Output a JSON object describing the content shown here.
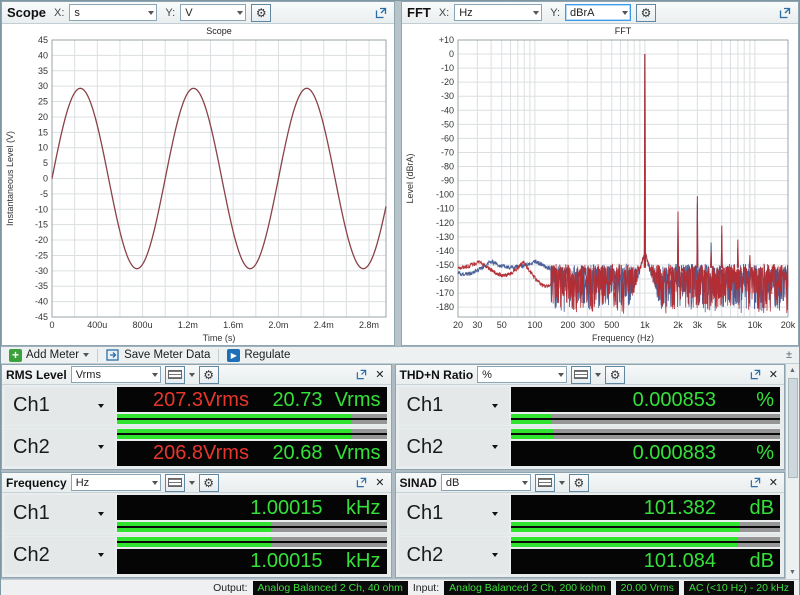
{
  "icons": {
    "add": "+",
    "play": "▶",
    "gear": "⚙",
    "caret": "",
    "close": "✕",
    "scroll_up": "▲",
    "scroll_down": "▼",
    "pin": "±"
  },
  "scope_panel": {
    "title": "Scope",
    "x_label": "X:",
    "x_value": "s",
    "y_label": "Y:",
    "y_value": "V"
  },
  "fft_panel": {
    "title": "FFT",
    "x_label": "X:",
    "x_value": "Hz",
    "y_label": "Y:",
    "y_value": "dBrA"
  },
  "toolbar": {
    "add_meter": "Add Meter",
    "save_meter_data": "Save Meter Data",
    "regulate": "Regulate"
  },
  "chart_data": [
    {
      "type": "line",
      "title": "Scope",
      "xlabel": "Time (s)",
      "ylabel": "Instantaneous Level (V)",
      "ylim": [
        -45,
        45
      ],
      "ytick_step": 5,
      "xlim_s": [
        0,
        0.00295
      ],
      "x_grid_step_s": 0.0002,
      "xticks": [
        {
          "v": 0,
          "label": "0"
        },
        {
          "v": 0.0004,
          "label": "400u"
        },
        {
          "v": 0.0008,
          "label": "800u"
        },
        {
          "v": 0.0012,
          "label": "1.2m"
        },
        {
          "v": 0.0016,
          "label": "1.6m"
        },
        {
          "v": 0.002,
          "label": "2.0m"
        },
        {
          "v": 0.0024,
          "label": "2.4m"
        },
        {
          "v": 0.0028,
          "label": "2.8m"
        }
      ],
      "signal": {
        "shape": "sine",
        "amplitude_v": 29.3,
        "frequency_hz": 1000,
        "phase_deg": 0
      },
      "trace_color": "#8a424a",
      "grid": true
    },
    {
      "type": "line",
      "x_scale": "log",
      "title": "FFT",
      "xlabel": "Frequency (Hz)",
      "ylabel": "Level (dBrA)",
      "ylim": [
        -187,
        10
      ],
      "ytick_min": -180,
      "ytick_max": 10,
      "ytick_step": 10,
      "xlim": [
        20,
        20000
      ],
      "xticks_labeled": [
        [
          20,
          "20"
        ],
        [
          30,
          "30"
        ],
        [
          50,
          "50"
        ],
        [
          100,
          "100"
        ],
        [
          200,
          "200"
        ],
        [
          300,
          "300"
        ],
        [
          500,
          "500"
        ],
        [
          1000,
          "1k"
        ],
        [
          2000,
          "2k"
        ],
        [
          3000,
          "3k"
        ],
        [
          5000,
          "5k"
        ],
        [
          10000,
          "10k"
        ],
        [
          20000,
          "20k"
        ]
      ],
      "fundamental": {
        "f": 1000,
        "level_db": 0
      },
      "harmonics": [
        {
          "f": 2000,
          "ch1_db": -118,
          "ch2_db": -112
        },
        {
          "f": 3000,
          "ch1_db": -106,
          "ch2_db": -101
        },
        {
          "f": 4000,
          "ch1_db": -134,
          "ch2_db": -141
        },
        {
          "f": 5000,
          "ch1_db": -128,
          "ch2_db": -122
        },
        {
          "f": 7000,
          "ch1_db": -138,
          "ch2_db": -132
        },
        {
          "f": 9000,
          "ch1_db": -149,
          "ch2_db": -143
        }
      ],
      "noise_floor_db": -157,
      "channels": [
        {
          "name": "Ch1",
          "color": "#4a5f96"
        },
        {
          "name": "Ch2",
          "color": "#b22e34"
        }
      ],
      "grid": true
    }
  ],
  "meters": [
    {
      "title": "RMS Level",
      "unit": "Vrms",
      "rows": [
        {
          "channel": "Ch1",
          "red_value": "207.3Vrms",
          "value": "20.73",
          "unit": "Vrms",
          "bar_pct": 87
        },
        {
          "channel": "Ch2",
          "red_value": "206.8Vrms",
          "value": "20.68",
          "unit": "Vrms",
          "bar_pct": 87
        }
      ]
    },
    {
      "title": "THD+N Ratio",
      "unit": "%",
      "rows": [
        {
          "channel": "Ch1",
          "value": "0.000853",
          "unit": "%",
          "bar_pct": 15
        },
        {
          "channel": "Ch2",
          "value": "0.000883",
          "unit": "%",
          "bar_pct": 16
        }
      ]
    },
    {
      "title": "Frequency",
      "unit": "Hz",
      "rows": [
        {
          "channel": "Ch1",
          "value": "1.00015",
          "unit": "kHz",
          "bar_pct": 57
        },
        {
          "channel": "Ch2",
          "value": "1.00015",
          "unit": "kHz",
          "bar_pct": 57
        }
      ]
    },
    {
      "title": "SINAD",
      "unit": "dB",
      "rows": [
        {
          "channel": "Ch1",
          "value": "101.382",
          "unit": "dB",
          "bar_pct": 85
        },
        {
          "channel": "Ch2",
          "value": "101.084",
          "unit": "dB",
          "bar_pct": 84
        }
      ]
    }
  ],
  "status_bar": {
    "output_label": "Output:",
    "output_value": "Analog Balanced 2 Ch, 40 ohm",
    "input_label": "Input:",
    "input_badges": [
      "Analog Balanced 2 Ch, 200 kohm",
      "20.00 Vrms",
      "AC (<10 Hz) - 20 kHz"
    ]
  }
}
